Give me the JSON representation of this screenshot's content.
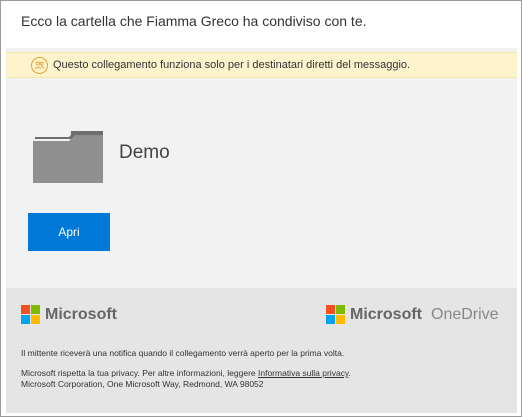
{
  "header": {
    "title": "Ecco la cartella che Fiamma Greco ha condiviso con te."
  },
  "notice": {
    "text": "Questo collegamento funziona solo per i destinatari diretti del messaggio."
  },
  "item": {
    "name": "Demo",
    "open_label": "Apri"
  },
  "footer": {
    "brand_left": "Microsoft",
    "brand_right_ms": "Microsoft",
    "brand_right_product": "OneDrive",
    "notify_text": "Il mittente riceverà una notifica quando il collegamento verrà aperto per la prima volta.",
    "privacy_text": "Microsoft rispetta la tua privacy. Per altre informazioni, leggere ",
    "privacy_link": "Informativa sulla privacy",
    "privacy_end": ".",
    "address": "Microsoft Corporation, One Microsoft Way, Redmond, WA 98052"
  },
  "colors": {
    "accent": "#0078d7",
    "notice_bg": "#fdf3cd",
    "ms_red": "#f25022",
    "ms_green": "#7fba00",
    "ms_blue": "#00a4ef",
    "ms_yellow": "#ffb900"
  }
}
